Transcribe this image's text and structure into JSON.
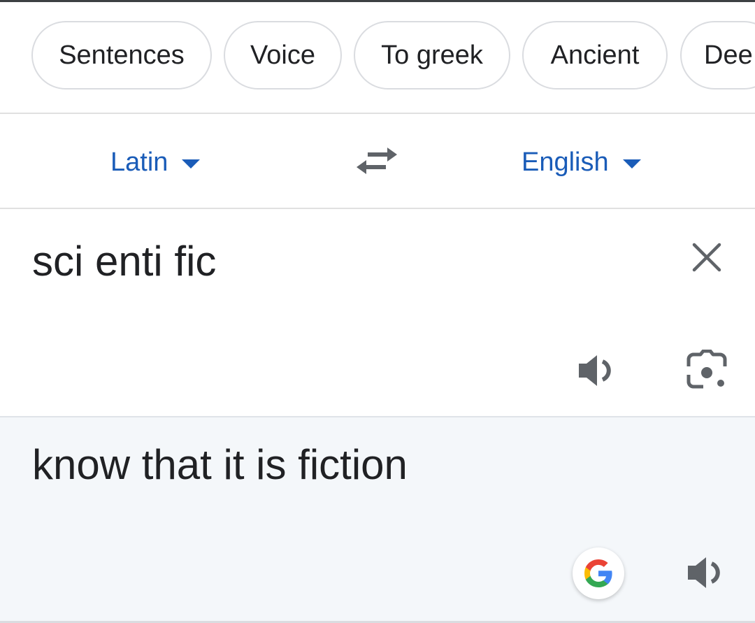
{
  "chips": [
    {
      "label": "Sentences"
    },
    {
      "label": "Voice"
    },
    {
      "label": "To greek"
    },
    {
      "label": "Ancient"
    },
    {
      "label": "Dee"
    }
  ],
  "languages": {
    "source": "Latin",
    "target": "English"
  },
  "source": {
    "text": "sci enti fic"
  },
  "translation": {
    "text": "know that it is fiction"
  },
  "icons": {
    "swap": "swap-languages-icon",
    "clear": "close-icon",
    "speak": "speaker-icon",
    "lens": "camera-lens-icon",
    "google": "google-logo"
  },
  "colors": {
    "accent": "#1a5cb8",
    "result_background": "#f4f7fa",
    "icon_gray": "#5f6368"
  }
}
